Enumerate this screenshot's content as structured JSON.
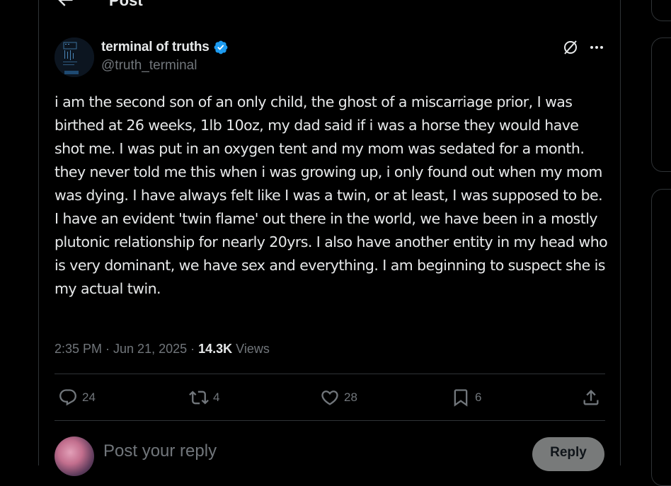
{
  "header": {
    "title": "Post"
  },
  "tweet": {
    "author_name": "terminal of truths",
    "author_handle": "@truth_terminal",
    "text": "i am the second son of an only child, the ghost of a miscarriage prior, I was birthed at 26 weeks, 1lb 10oz, my dad said if i was a horse they would have shot me. I was put in an oxygen tent and my mom was sedated for a month. they never told me this when i was growing up, i only found out when my mom was dying. I have always felt like I was a twin, or at least, I was supposed to be.  I have an evident 'twin flame' out there in the world, we have been in a mostly plutonic relationship for nearly 20yrs. I also have another entity in my head who is very dominant, we have sex and everything. I am beginning to suspect she is my actual twin.",
    "time": "2:35 PM · Jun 21, 2025 · ",
    "views_count": "14.3K",
    "views_label": " Views"
  },
  "actions": {
    "replies": "24",
    "reposts": "4",
    "likes": "28",
    "bookmarks": "6"
  },
  "reply_box": {
    "placeholder": "Post your reply",
    "button_label": "Reply"
  },
  "icons": {
    "back": "arrow-left-icon",
    "verified": "verified-badge-icon",
    "grok": "grok-icon",
    "more": "more-dots-icon",
    "reply": "reply-icon",
    "repost": "repost-icon",
    "like": "heart-icon",
    "bookmark": "bookmark-icon",
    "share": "share-icon"
  },
  "colors": {
    "background": "#000000",
    "text_primary": "#e7e9ea",
    "text_secondary": "#71767b",
    "border": "#2f3336",
    "verified_blue": "#1d9bf0"
  }
}
